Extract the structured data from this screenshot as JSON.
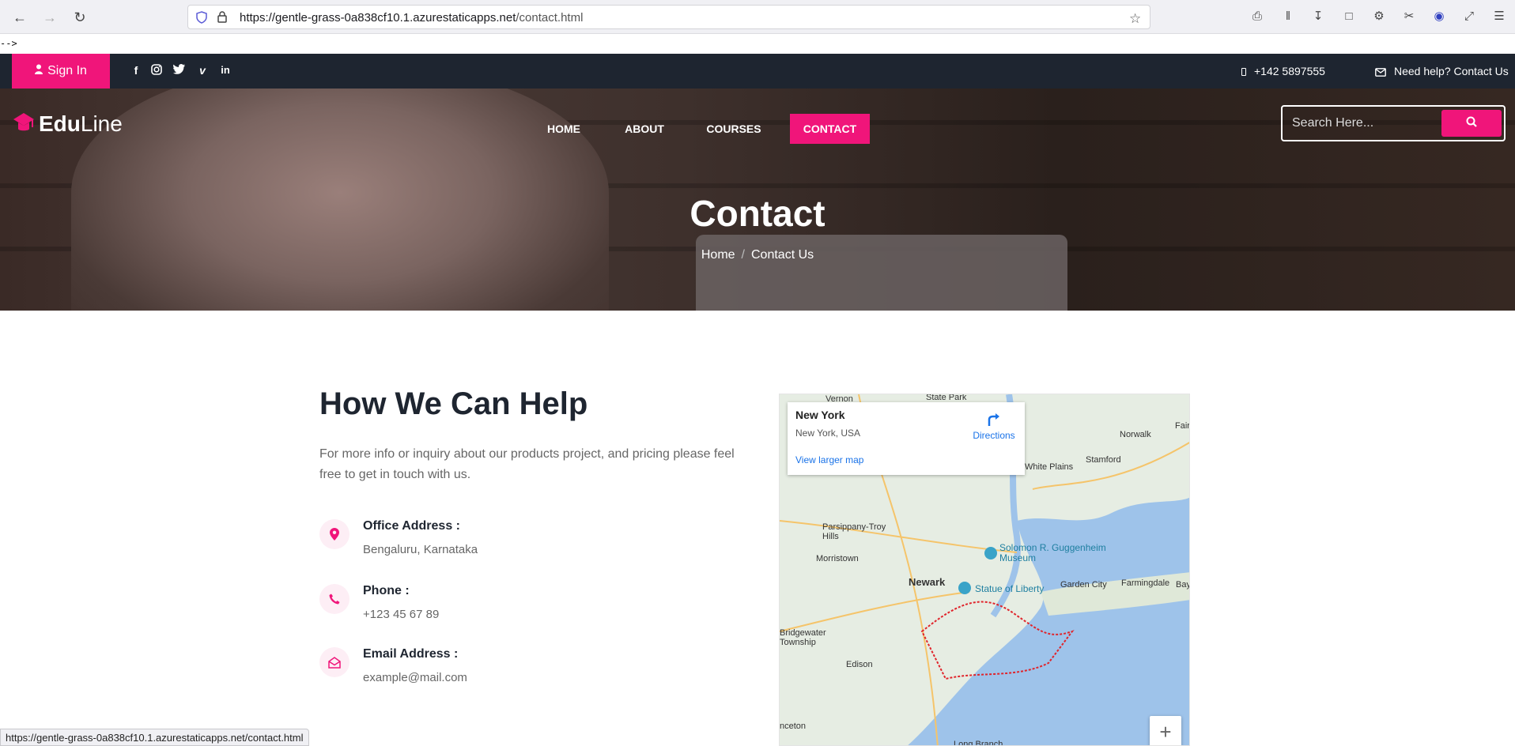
{
  "browser": {
    "url_host": "https://gentle-grass-0a838cf10.1.azurestaticapps.net",
    "url_path": "/contact.html",
    "status_url": "https://gentle-grass-0a838cf10.1.azurestaticapps.net/contact.html"
  },
  "stray_text": "-->",
  "topbar": {
    "signin_label": "Sign In",
    "social_icons": [
      "facebook-icon",
      "instagram-icon",
      "twitter-icon",
      "vimeo-icon",
      "linkedin-icon"
    ],
    "phone": "+142 5897555",
    "help": "Need help? Contact Us"
  },
  "header": {
    "logo_bold": "Edu",
    "logo_light": "Line",
    "nav": [
      {
        "label": "HOME"
      },
      {
        "label": "ABOUT"
      },
      {
        "label": "COURSES"
      },
      {
        "label": "CONTACT",
        "active": true
      }
    ],
    "search_placeholder": "Search Here..."
  },
  "hero": {
    "title": "Contact",
    "breadcrumb_home": "Home",
    "breadcrumb_current": "Contact Us"
  },
  "help": {
    "title": "How We Can Help",
    "description": "For more info or inquiry about our products project, and pricing please feel free to get in touch with us.",
    "items": [
      {
        "label": "Office Address :",
        "value": "Bengaluru, Karnataka",
        "icon": "location-pin-icon"
      },
      {
        "label": "Phone :",
        "value": "+123 45 67 89",
        "icon": "phone-icon"
      },
      {
        "label": "Email Address :",
        "value": "example@mail.com",
        "icon": "envelope-open-icon"
      }
    ]
  },
  "map": {
    "place_name": "New York",
    "place_sub": "New York, USA",
    "directions": "Directions",
    "view_larger": "View larger map",
    "labels": [
      "Vernon",
      "State Park",
      "Norwalk",
      "Stamford",
      "White Plains",
      "Parsippany-Troy Hills",
      "Morristown",
      "Solomon R. Guggenheim Museum",
      "Newark",
      "Statue of Liberty",
      "Garden City",
      "Farmingdale",
      "Bay",
      "Bridgewater Township",
      "Edison",
      "nceton",
      "Long Branch",
      "Fair"
    ],
    "colors": {
      "water": "#9ec3ea",
      "land": "#e6ede3",
      "road": "#f5c46a",
      "boundary": "#e0242b"
    }
  },
  "colors": {
    "accent": "#f0157a",
    "dark": "#1e2530"
  }
}
